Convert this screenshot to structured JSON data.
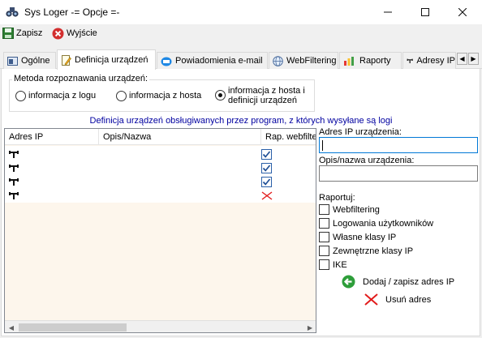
{
  "window": {
    "title": "Sys Loger -= Opcje =-"
  },
  "toolbar": {
    "save_label": "Zapisz",
    "exit_label": "Wyjście"
  },
  "tabs": [
    {
      "label": "Ogólne"
    },
    {
      "label": "Definicja urządzeń"
    },
    {
      "label": "Powiadomienia e-mail"
    },
    {
      "label": "WebFiltering"
    },
    {
      "label": "Raporty"
    },
    {
      "label": "Adresy IP"
    }
  ],
  "method": {
    "label": "Metoda rozpoznawania urządzeń:",
    "options": [
      "informacja z logu",
      "informacja z hosta",
      "informacja z hosta i\ndefinicji urządzeń"
    ],
    "selected": 2
  },
  "list_caption": "Definicja urządzeń obsługiwanych przez program, z których wysyłane są logi",
  "device_list": {
    "columns": [
      "Adres IP",
      "Opis/Nazwa",
      "Rap. webfilter"
    ],
    "rows": [
      {
        "ip": "",
        "name": "",
        "report": "checked"
      },
      {
        "ip": "",
        "name": "",
        "report": "checked"
      },
      {
        "ip": "",
        "name": "",
        "report": "checked"
      },
      {
        "ip": "",
        "name": "",
        "report": "none"
      }
    ]
  },
  "form": {
    "ip_label": "Adres IP urządzenia:",
    "ip_value": "",
    "desc_label": "Opis/nazwa urządzenia:",
    "desc_value": "",
    "report_label": "Raportuj:",
    "report_options": [
      "Webfiltering",
      "Logowania użytkowników",
      "Własne klasy IP",
      "Zewnętrzne klasy IP",
      "IKE"
    ],
    "add_label": "Dodaj / zapisz adres IP",
    "remove_label": "Usuń adres"
  }
}
